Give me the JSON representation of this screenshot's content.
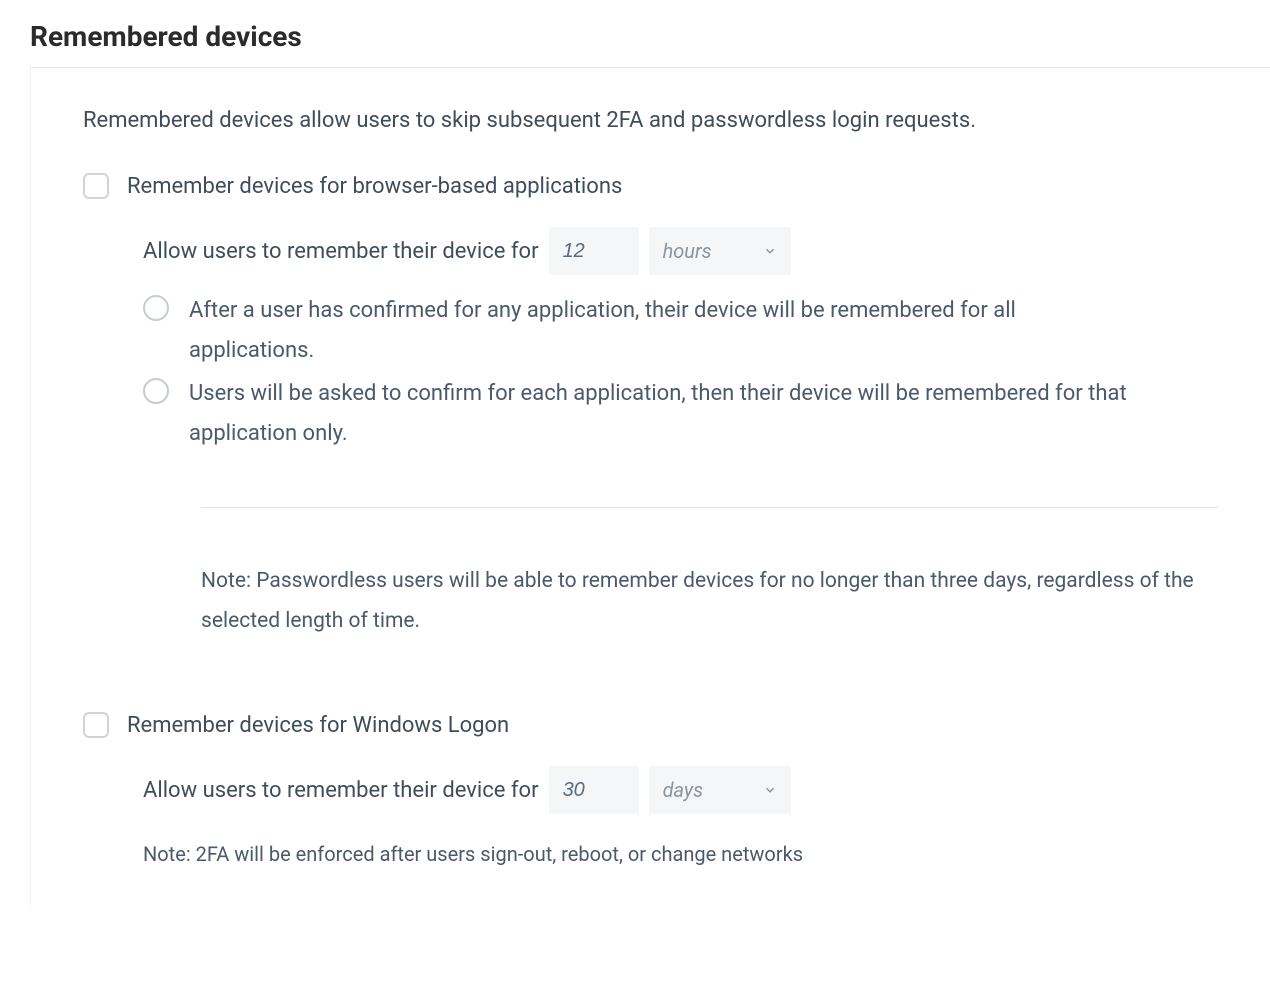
{
  "section": {
    "title": "Remembered devices",
    "intro": "Remembered devices allow users to skip subsequent 2FA and passwordless login requests."
  },
  "browser": {
    "checkbox_label": "Remember devices for browser-based applications",
    "allow_prefix": "Allow users to remember their device for",
    "duration_value": "12",
    "duration_unit": "hours",
    "radio_all": "After a user has confirmed for any application, their device will be remembered for all applications.",
    "radio_each": "Users will be asked to confirm for each application, then their device will be remembered for that application only.",
    "note": "Note: Passwordless users will be able to remember devices for no longer than three days, regardless of the selected length of time."
  },
  "windows": {
    "checkbox_label": "Remember devices for Windows Logon",
    "allow_prefix": "Allow users to remember their device for",
    "duration_value": "30",
    "duration_unit": "days",
    "note": "Note: 2FA will be enforced after users sign-out, reboot, or change networks"
  }
}
